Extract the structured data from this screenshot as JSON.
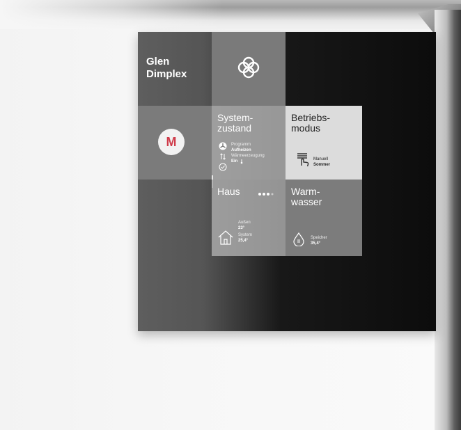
{
  "brand": {
    "line1": "Glen",
    "line2": "Dimplex"
  },
  "mode": {
    "letter": "M"
  },
  "system": {
    "title_line1": "System-",
    "title_line2": "zustand",
    "program_label": "Programm",
    "program_value": "Aufheizen",
    "heat_label": "Wärmeerzeugung",
    "heat_value": "Ein"
  },
  "betrieb": {
    "title_line1": "Betriebs-",
    "title_line2": "modus",
    "mode_label": "Manuell",
    "mode_value": "Sommer"
  },
  "haus": {
    "title": "Haus",
    "outside_label": "Außen",
    "outside_value": "23°",
    "system_label": "System",
    "system_value": "25,4°"
  },
  "warmwasser": {
    "title_line1": "Warm-",
    "title_line2": "wasser",
    "storage_label": "Speicher",
    "storage_value": "35,4°"
  },
  "colors": {
    "accent": "#cf3b4a"
  },
  "icons": [
    "celtic-knot-icon",
    "fan-icon",
    "arrows-icon",
    "check-icon",
    "thermometer-icon",
    "hand-icon",
    "more-dots-icon",
    "house-icon",
    "drop-icon"
  ]
}
